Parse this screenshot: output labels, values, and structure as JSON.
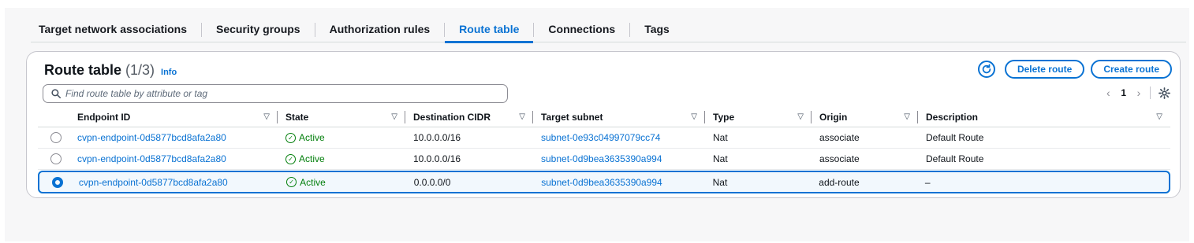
{
  "tabs": [
    {
      "label": "Target network associations",
      "active": false
    },
    {
      "label": "Security groups",
      "active": false
    },
    {
      "label": "Authorization rules",
      "active": false
    },
    {
      "label": "Route table",
      "active": true
    },
    {
      "label": "Connections",
      "active": false
    },
    {
      "label": "Tags",
      "active": false
    }
  ],
  "header": {
    "title": "Route table",
    "count": "(1/3)",
    "info": "Info"
  },
  "actions": {
    "refresh_icon": "refresh-icon",
    "delete_label": "Delete route",
    "create_label": "Create route"
  },
  "search": {
    "placeholder": "Find route table by attribute or tag",
    "value": ""
  },
  "pagination": {
    "current_page": "1",
    "prev": "‹",
    "next": "›"
  },
  "table": {
    "columns": [
      "Endpoint ID",
      "State",
      "Destination CIDR",
      "Target subnet",
      "Type",
      "Origin",
      "Description"
    ],
    "rows": [
      {
        "selected": false,
        "endpoint_id": "cvpn-endpoint-0d5877bcd8afa2a80",
        "state": "Active",
        "destination_cidr": "10.0.0.0/16",
        "target_subnet": "subnet-0e93c04997079cc74",
        "type": "Nat",
        "origin": "associate",
        "description": "Default Route"
      },
      {
        "selected": false,
        "endpoint_id": "cvpn-endpoint-0d5877bcd8afa2a80",
        "state": "Active",
        "destination_cidr": "10.0.0.0/16",
        "target_subnet": "subnet-0d9bea3635390a994",
        "type": "Nat",
        "origin": "associate",
        "description": "Default Route"
      },
      {
        "selected": true,
        "endpoint_id": "cvpn-endpoint-0d5877bcd8afa2a80",
        "state": "Active",
        "destination_cidr": "0.0.0.0/0",
        "target_subnet": "subnet-0d9bea3635390a994",
        "type": "Nat",
        "origin": "add-route",
        "description": "–"
      }
    ]
  },
  "colors": {
    "accent": "#0972d3",
    "success": "#037f0c",
    "text": "#0f141a"
  }
}
